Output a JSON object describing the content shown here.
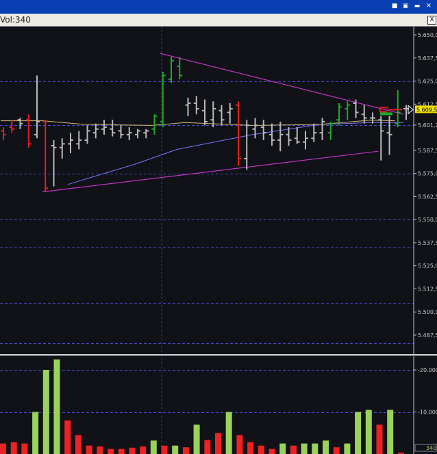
{
  "window": {
    "vol_label": "Vol:",
    "vol_value": "340",
    "close_glyph": "X",
    "titlebar_icons": [
      "pin-icon",
      "restore-icon",
      "minimize-icon",
      "close-icon"
    ]
  },
  "colors": {
    "background": "#101218",
    "up_bar": "#1faa2a",
    "down_bar": "#e41e1e",
    "neutral_bar": "#b9b9b9",
    "ma_slow": "#7777ff",
    "ma_fast": "#d9b870",
    "trendline": "#c236c2",
    "gridline": "#4b4bd6",
    "vol_up": "#9ad25a",
    "vol_down": "#ee2222",
    "last_price_tag": "#f0e000"
  },
  "chart_data": [
    {
      "type": "ohlc",
      "y_tick_labels": [
        "5.650,0",
        "5.637,5",
        "5.625,0",
        "5.612,5",
        "5.601,2",
        "5.587,5",
        "5.575,0",
        "5.562,5",
        "5.550,0",
        "5.537,5",
        "5.525,0",
        "5.512,5",
        "5.500,0",
        "5.487,5"
      ],
      "y_tick_values": [
        5650.0,
        5637.5,
        5625.0,
        5612.5,
        5601.2,
        5587.5,
        5575.0,
        5562.5,
        5550.0,
        5537.5,
        5525.0,
        5512.5,
        5500.0,
        5487.5
      ],
      "last_price_label": "5.609,5",
      "last_price": 5609.5,
      "ylim": [
        5478,
        5655
      ],
      "grid": "horizontal dashed",
      "bars": [
        {
          "i": 0,
          "o": 5598,
          "h": 5600,
          "l": 5593,
          "c": 5596,
          "d": "down"
        },
        {
          "i": 1,
          "o": 5600,
          "h": 5604,
          "l": 5597,
          "c": 5599,
          "d": "down"
        },
        {
          "i": 2,
          "o": 5604,
          "h": 5605,
          "l": 5599,
          "c": 5602,
          "d": "neutral"
        },
        {
          "i": 3,
          "o": 5604,
          "h": 5607,
          "l": 5589,
          "c": 5591,
          "d": "down"
        },
        {
          "i": 4,
          "o": 5596,
          "h": 5628,
          "l": 5594,
          "c": 5603,
          "d": "neutral"
        },
        {
          "i": 5,
          "o": 5603,
          "h": 5604,
          "l": 5565,
          "c": 5567,
          "d": "down"
        },
        {
          "i": 6,
          "o": 5590,
          "h": 5593,
          "l": 5568,
          "c": 5589,
          "d": "neutral"
        },
        {
          "i": 7,
          "o": 5589,
          "h": 5594,
          "l": 5583,
          "c": 5591,
          "d": "neutral"
        },
        {
          "i": 8,
          "o": 5591,
          "h": 5597,
          "l": 5586,
          "c": 5593,
          "d": "neutral"
        },
        {
          "i": 9,
          "o": 5591,
          "h": 5598,
          "l": 5588,
          "c": 5593,
          "d": "neutral"
        },
        {
          "i": 10,
          "o": 5593,
          "h": 5601,
          "l": 5591,
          "c": 5598,
          "d": "neutral"
        },
        {
          "i": 11,
          "o": 5597,
          "h": 5602,
          "l": 5594,
          "c": 5599,
          "d": "neutral"
        },
        {
          "i": 12,
          "o": 5599,
          "h": 5604,
          "l": 5596,
          "c": 5600,
          "d": "neutral"
        },
        {
          "i": 13,
          "o": 5599,
          "h": 5604,
          "l": 5595,
          "c": 5597,
          "d": "neutral"
        },
        {
          "i": 14,
          "o": 5598,
          "h": 5601,
          "l": 5594,
          "c": 5596,
          "d": "neutral"
        },
        {
          "i": 15,
          "o": 5596,
          "h": 5600,
          "l": 5593,
          "c": 5597,
          "d": "neutral"
        },
        {
          "i": 16,
          "o": 5596,
          "h": 5599,
          "l": 5594,
          "c": 5598,
          "d": "neutral"
        },
        {
          "i": 17,
          "o": 5597,
          "h": 5599,
          "l": 5594,
          "c": 5598,
          "d": "neutral"
        },
        {
          "i": 18,
          "o": 5599,
          "h": 5607,
          "l": 5596,
          "c": 5606,
          "d": "up"
        },
        {
          "i": 19,
          "o": 5603,
          "h": 5630,
          "l": 5600,
          "c": 5628,
          "d": "up"
        },
        {
          "i": 20,
          "o": 5626,
          "h": 5638,
          "l": 5624,
          "c": 5636,
          "d": "up"
        },
        {
          "i": 21,
          "o": 5633,
          "h": 5638,
          "l": 5626,
          "c": 5628,
          "d": "up"
        },
        {
          "i": 22,
          "o": 5612,
          "h": 5616,
          "l": 5606,
          "c": 5613,
          "d": "neutral"
        },
        {
          "i": 23,
          "o": 5613,
          "h": 5617,
          "l": 5607,
          "c": 5610,
          "d": "neutral"
        },
        {
          "i": 24,
          "o": 5609,
          "h": 5615,
          "l": 5601,
          "c": 5603,
          "d": "neutral"
        },
        {
          "i": 25,
          "o": 5604,
          "h": 5614,
          "l": 5600,
          "c": 5610,
          "d": "neutral"
        },
        {
          "i": 26,
          "o": 5609,
          "h": 5612,
          "l": 5601,
          "c": 5604,
          "d": "neutral"
        },
        {
          "i": 27,
          "o": 5608,
          "h": 5613,
          "l": 5602,
          "c": 5610,
          "d": "neutral"
        },
        {
          "i": 28,
          "o": 5612,
          "h": 5614,
          "l": 5579,
          "c": 5583,
          "d": "down"
        },
        {
          "i": 29,
          "o": 5583,
          "h": 5604,
          "l": 5577,
          "c": 5601,
          "d": "neutral"
        },
        {
          "i": 30,
          "o": 5599,
          "h": 5605,
          "l": 5594,
          "c": 5601,
          "d": "neutral"
        },
        {
          "i": 31,
          "o": 5600,
          "h": 5604,
          "l": 5593,
          "c": 5597,
          "d": "neutral"
        },
        {
          "i": 32,
          "o": 5596,
          "h": 5602,
          "l": 5590,
          "c": 5593,
          "d": "neutral"
        },
        {
          "i": 33,
          "o": 5593,
          "h": 5603,
          "l": 5587,
          "c": 5596,
          "d": "neutral"
        },
        {
          "i": 34,
          "o": 5596,
          "h": 5600,
          "l": 5590,
          "c": 5593,
          "d": "neutral"
        },
        {
          "i": 35,
          "o": 5594,
          "h": 5600,
          "l": 5591,
          "c": 5592,
          "d": "neutral"
        },
        {
          "i": 36,
          "o": 5592,
          "h": 5598,
          "l": 5588,
          "c": 5594,
          "d": "neutral"
        },
        {
          "i": 37,
          "o": 5594,
          "h": 5602,
          "l": 5592,
          "c": 5597,
          "d": "neutral"
        },
        {
          "i": 38,
          "o": 5597,
          "h": 5605,
          "l": 5593,
          "c": 5603,
          "d": "neutral"
        },
        {
          "i": 39,
          "o": 5597,
          "h": 5603,
          "l": 5593,
          "c": 5602,
          "d": "up"
        },
        {
          "i": 40,
          "o": 5604,
          "h": 5613,
          "l": 5601,
          "c": 5611,
          "d": "up"
        },
        {
          "i": 41,
          "o": 5610,
          "h": 5614,
          "l": 5604,
          "c": 5612,
          "d": "up"
        },
        {
          "i": 42,
          "o": 5613,
          "h": 5615,
          "l": 5605,
          "c": 5608,
          "d": "neutral"
        },
        {
          "i": 43,
          "o": 5607,
          "h": 5612,
          "l": 5602,
          "c": 5605,
          "d": "neutral"
        },
        {
          "i": 44,
          "o": 5605,
          "h": 5608,
          "l": 5602,
          "c": 5605,
          "d": "neutral"
        },
        {
          "i": 45,
          "o": 5604,
          "h": 5606,
          "l": 5582,
          "c": 5598,
          "d": "neutral"
        },
        {
          "i": 46,
          "o": 5597,
          "h": 5606,
          "l": 5585,
          "c": 5596,
          "d": "neutral"
        },
        {
          "i": 47,
          "o": 5602,
          "h": 5620,
          "l": 5600,
          "c": 5608,
          "d": "up"
        },
        {
          "i": 48,
          "o": 5610,
          "h": 5612,
          "l": 5604,
          "c": 5610,
          "d": "neutral"
        }
      ],
      "ma_fast": [
        [
          0,
          5603.5
        ],
        [
          5,
          5603.5
        ],
        [
          10,
          5601.5
        ],
        [
          18,
          5601
        ],
        [
          22,
          5602.5
        ],
        [
          30,
          5601
        ],
        [
          38,
          5601.5
        ],
        [
          44,
          5603.8
        ],
        [
          47,
          5603.5
        ]
      ],
      "ma_slow": [
        [
          8,
          5569
        ],
        [
          16,
          5580
        ],
        [
          21,
          5588
        ],
        [
          30,
          5596
        ],
        [
          38,
          5601.5
        ],
        [
          44,
          5602.5
        ],
        [
          48,
          5602.5
        ]
      ],
      "trendlines": [
        {
          "from": [
            19,
            5640
          ],
          "to": [
            48,
            5607
          ]
        },
        {
          "from": [
            5,
            5565
          ],
          "to": [
            45,
            5587
          ]
        }
      ]
    },
    {
      "type": "bar",
      "y_tick_labels": [
        "-20.000",
        "-10.000",
        "340"
      ],
      "y_tick_values": [
        20000,
        10000
      ],
      "last_volume": 340,
      "ylim": [
        0,
        24000
      ],
      "volumes": [
        {
          "v": 2500,
          "d": "down"
        },
        {
          "v": 2800,
          "d": "down"
        },
        {
          "v": 2500,
          "d": "down"
        },
        {
          "v": 10000,
          "d": "up"
        },
        {
          "v": 20000,
          "d": "up"
        },
        {
          "v": 22500,
          "d": "up"
        },
        {
          "v": 8000,
          "d": "down"
        },
        {
          "v": 4500,
          "d": "down"
        },
        {
          "v": 2000,
          "d": "down"
        },
        {
          "v": 1800,
          "d": "down"
        },
        {
          "v": 1200,
          "d": "down"
        },
        {
          "v": 1200,
          "d": "down"
        },
        {
          "v": 1500,
          "d": "down"
        },
        {
          "v": 1800,
          "d": "down"
        },
        {
          "v": 3200,
          "d": "up"
        },
        {
          "v": 2000,
          "d": "down"
        },
        {
          "v": 2000,
          "d": "up"
        },
        {
          "v": 1600,
          "d": "down"
        },
        {
          "v": 7000,
          "d": "up"
        },
        {
          "v": 3300,
          "d": "down"
        },
        {
          "v": 5000,
          "d": "down"
        },
        {
          "v": 10000,
          "d": "up"
        },
        {
          "v": 4500,
          "d": "down"
        },
        {
          "v": 2800,
          "d": "down"
        },
        {
          "v": 2000,
          "d": "down"
        },
        {
          "v": 1200,
          "d": "down"
        },
        {
          "v": 2500,
          "d": "up"
        },
        {
          "v": 2000,
          "d": "down"
        },
        {
          "v": 2500,
          "d": "up"
        },
        {
          "v": 2500,
          "d": "up"
        },
        {
          "v": 3200,
          "d": "up"
        },
        {
          "v": 1600,
          "d": "down"
        },
        {
          "v": 2500,
          "d": "up"
        },
        {
          "v": 10000,
          "d": "up"
        },
        {
          "v": 10500,
          "d": "up"
        },
        {
          "v": 7000,
          "d": "down"
        },
        {
          "v": 10500,
          "d": "up"
        },
        {
          "v": 340,
          "d": "down"
        }
      ]
    }
  ]
}
